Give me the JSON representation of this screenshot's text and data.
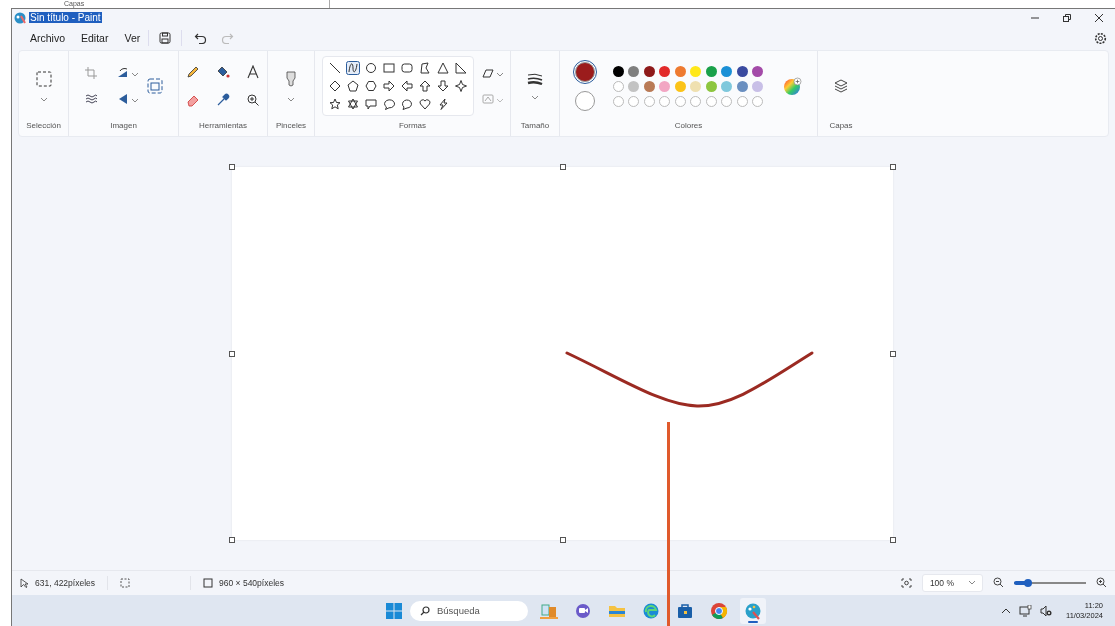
{
  "background_window": {
    "label": "Capas"
  },
  "window": {
    "title": "Sin título - Paint",
    "title_highlighted": true
  },
  "menu": [
    {
      "label": "Archivo"
    },
    {
      "label": "Editar"
    },
    {
      "label": "Ver"
    }
  ],
  "quick_actions": {
    "undo": {
      "disabled": false
    },
    "redo": {
      "disabled": true
    }
  },
  "ribbon": {
    "groups": [
      "Selección",
      "Imagen",
      "Herramientas",
      "Pinceles",
      "Formas",
      "Tamaño",
      "Colores",
      "Capas"
    ],
    "shapes": [
      {
        "kind": "line",
        "selected": false
      },
      {
        "kind": "curve",
        "selected": true
      },
      {
        "kind": "oval",
        "selected": false
      },
      {
        "kind": "rect",
        "selected": false
      },
      {
        "kind": "roundrect",
        "selected": false
      },
      {
        "kind": "polygon",
        "selected": false
      },
      {
        "kind": "triangle",
        "selected": false
      },
      {
        "kind": "righttriangle",
        "selected": false
      },
      {
        "kind": "diamond",
        "selected": false
      },
      {
        "kind": "pentagon",
        "selected": false
      },
      {
        "kind": "hexagon",
        "selected": false
      },
      {
        "kind": "arrowright",
        "selected": false
      },
      {
        "kind": "arrowleft",
        "selected": false
      },
      {
        "kind": "arrowup",
        "selected": false
      },
      {
        "kind": "arrowdown",
        "selected": false
      },
      {
        "kind": "star4",
        "selected": false
      },
      {
        "kind": "star5",
        "selected": false
      },
      {
        "kind": "star6",
        "selected": false
      },
      {
        "kind": "calloutrect",
        "selected": false
      },
      {
        "kind": "calloutoval",
        "selected": false
      },
      {
        "kind": "calloutcloud",
        "selected": false
      },
      {
        "kind": "heart",
        "selected": false
      },
      {
        "kind": "lightning",
        "selected": false
      }
    ],
    "colors": {
      "primary": {
        "color": "#9b1c1c",
        "selected": true
      },
      "secondary": {
        "color": "#ffffff",
        "selected": false
      },
      "palette": [
        {
          "kind": "swatch",
          "color": "#000000"
        },
        {
          "kind": "swatch",
          "color": "#7f7f7f"
        },
        {
          "kind": "swatch",
          "color": "#8e1a1a"
        },
        {
          "kind": "swatch",
          "color": "#e22a2a"
        },
        {
          "kind": "swatch",
          "color": "#ee7a30"
        },
        {
          "kind": "swatch",
          "color": "#ffe81a"
        },
        {
          "kind": "swatch",
          "color": "#1aa14a"
        },
        {
          "kind": "swatch",
          "color": "#1b90d6"
        },
        {
          "kind": "swatch",
          "color": "#3a4aa0"
        },
        {
          "kind": "swatch",
          "color": "#a34aa8"
        },
        {
          "kind": "swatch",
          "color": "#ffffff"
        },
        {
          "kind": "swatch",
          "color": "#c3c3c3"
        },
        {
          "kind": "swatch",
          "color": "#b97a56"
        },
        {
          "kind": "swatch",
          "color": "#f2a6c3"
        },
        {
          "kind": "swatch",
          "color": "#fbc318"
        },
        {
          "kind": "swatch",
          "color": "#efe0b0"
        },
        {
          "kind": "swatch",
          "color": "#8dc63f"
        },
        {
          "kind": "swatch",
          "color": "#7fc8dc"
        },
        {
          "kind": "swatch",
          "color": "#6a8fc0"
        },
        {
          "kind": "swatch",
          "color": "#c8bfe7"
        },
        {
          "kind": "empty"
        },
        {
          "kind": "empty"
        },
        {
          "kind": "empty"
        },
        {
          "kind": "empty"
        },
        {
          "kind": "empty"
        },
        {
          "kind": "empty"
        },
        {
          "kind": "empty"
        },
        {
          "kind": "empty"
        },
        {
          "kind": "empty"
        },
        {
          "kind": "empty"
        }
      ]
    }
  },
  "status_bar": {
    "position": "631, 422píxeles",
    "canvas_size": "960 × 540píxeles",
    "zoom": "100 %",
    "zoom_slider": {
      "level": 0.2
    }
  },
  "taskbar": {
    "search_placeholder": "Búsqueda",
    "apps": [
      {
        "kind": "widget",
        "active": false
      },
      {
        "kind": "chat",
        "active": false
      },
      {
        "kind": "folder",
        "active": false
      },
      {
        "kind": "browser",
        "active": false
      },
      {
        "kind": "store",
        "active": false
      },
      {
        "kind": "chrome",
        "active": false
      },
      {
        "kind": "paint",
        "active": true
      }
    ],
    "time": "11:20",
    "date": "11/03/2024"
  }
}
